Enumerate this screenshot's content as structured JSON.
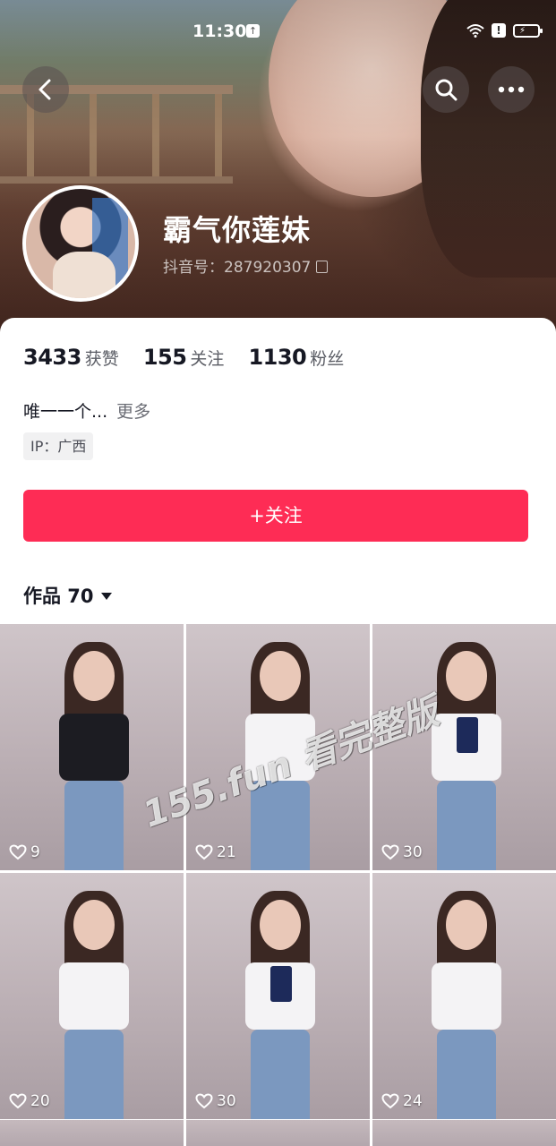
{
  "status_bar": {
    "time": "11:30"
  },
  "profile": {
    "nickname": "霸气你莲妹",
    "douyin_id": "抖音号：287920307"
  },
  "stats": [
    {
      "value": "3433",
      "label": "获赞"
    },
    {
      "value": "155",
      "label": "关注"
    },
    {
      "value": "1130",
      "label": "粉丝"
    }
  ],
  "bio": {
    "text": "唯一一个...",
    "more": "更多"
  },
  "ip": "IP：广西",
  "follow_button": "+关注",
  "works_tab": "作品 70",
  "watermark": "155.fun 看完整版",
  "videos": [
    {
      "likes": "9",
      "top": "black"
    },
    {
      "likes": "21",
      "top": "white"
    },
    {
      "likes": "30",
      "top": "white-navy"
    },
    {
      "likes": "20",
      "top": "white"
    },
    {
      "likes": "30",
      "top": "white-navy"
    },
    {
      "likes": "24",
      "top": "white"
    }
  ],
  "colors": {
    "accent": "#fe2c55",
    "text": "#161823"
  },
  "icons": [
    "back-icon",
    "search-icon",
    "more-icon",
    "wifi-icon",
    "battery-icon",
    "copy-icon",
    "heart-icon"
  ]
}
